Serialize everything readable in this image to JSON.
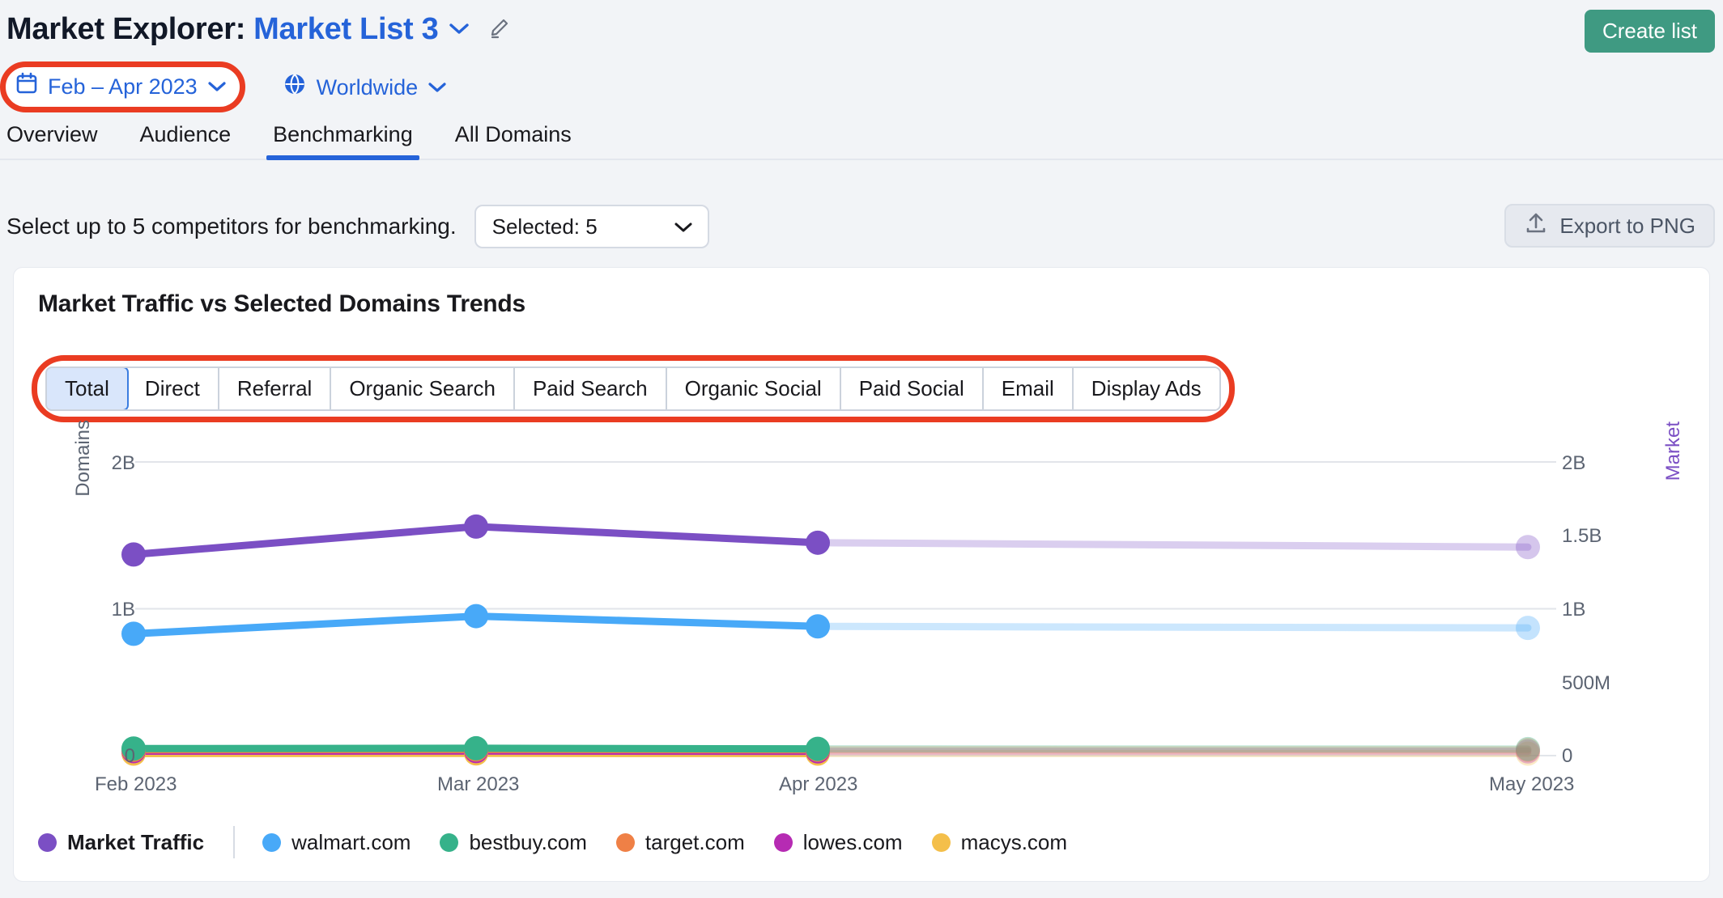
{
  "header": {
    "title_prefix": "Market Explorer:",
    "list_name": "Market List 3",
    "dropdown_icon": "chevron-down-icon",
    "edit_icon": "pencil-icon",
    "create_list_label": "Create list",
    "accent_blue": "#2563d9",
    "create_button_color": "#3f9a82"
  },
  "filters": {
    "date_range": "Feb – Apr 2023",
    "date_icon": "calendar-icon",
    "location": "Worldwide",
    "location_icon": "globe-icon",
    "highlight_color": "#ea3c22"
  },
  "tabs": [
    {
      "label": "Overview",
      "active": false
    },
    {
      "label": "Audience",
      "active": false
    },
    {
      "label": "Benchmarking",
      "active": true
    },
    {
      "label": "All Domains",
      "active": false
    }
  ],
  "toolbar": {
    "select_label": "Select up to 5 competitors for benchmarking.",
    "selected_value": "Selected: 5",
    "export_label": "Export to PNG",
    "export_icon": "upload-icon"
  },
  "card": {
    "title": "Market Traffic vs Selected Domains Trends"
  },
  "channels": [
    {
      "label": "Total",
      "active": true
    },
    {
      "label": "Direct",
      "active": false
    },
    {
      "label": "Referral",
      "active": false
    },
    {
      "label": "Organic Search",
      "active": false
    },
    {
      "label": "Paid Search",
      "active": false
    },
    {
      "label": "Organic Social",
      "active": false
    },
    {
      "label": "Paid Social",
      "active": false
    },
    {
      "label": "Email",
      "active": false
    },
    {
      "label": "Display Ads",
      "active": false
    }
  ],
  "chart_data": {
    "type": "line",
    "title": "Market Traffic vs Selected Domains Trends",
    "xlabel": "",
    "ylabel": "Domains",
    "y2label": "Market",
    "x": [
      "Feb 2023",
      "Mar 2023",
      "Apr 2023",
      "May 2023"
    ],
    "xtick_labels": [
      "Feb 2023",
      "Mar 2023",
      "Apr 2023",
      "May 2023"
    ],
    "ylim": [
      0,
      2000000000
    ],
    "ytick_labels": [
      "2B",
      "1B",
      "0"
    ],
    "ytick_values": [
      2000000000,
      1000000000,
      0
    ],
    "y2lim": [
      0,
      2000000000
    ],
    "y2tick_labels": [
      "2B",
      "1.5B",
      "1B",
      "500M",
      "0"
    ],
    "y2tick_values": [
      2000000000,
      1500000000,
      1000000000,
      500000000,
      0
    ],
    "grid": true,
    "legend_position": "bottom",
    "forecast_from": "Apr 2023",
    "series": [
      {
        "name": "Market Traffic",
        "color": "#7b4fc4",
        "axis": "right",
        "values": [
          1370000000,
          1560000000,
          1450000000,
          1420000000
        ]
      },
      {
        "name": "walmart.com",
        "color": "#48a9f8",
        "axis": "left",
        "values": [
          830000000,
          950000000,
          880000000,
          870000000
        ]
      },
      {
        "name": "bestbuy.com",
        "color": "#36b28a",
        "axis": "left",
        "values": [
          48000000,
          50000000,
          46000000,
          45000000
        ]
      },
      {
        "name": "target.com",
        "color": "#ef8046",
        "axis": "left",
        "values": [
          40000000,
          42000000,
          40000000,
          39000000
        ]
      },
      {
        "name": "lowes.com",
        "color": "#b62bb3",
        "axis": "left",
        "values": [
          30000000,
          31000000,
          29000000,
          29000000
        ]
      },
      {
        "name": "macys.com",
        "color": "#f4bf4a",
        "axis": "left",
        "values": [
          14000000,
          15000000,
          14000000,
          14000000
        ]
      }
    ]
  },
  "legend": [
    {
      "name": "Market Traffic",
      "color": "#7b4fc4",
      "primary": true
    },
    {
      "name": "walmart.com",
      "color": "#48a9f8",
      "primary": false
    },
    {
      "name": "bestbuy.com",
      "color": "#36b28a",
      "primary": false
    },
    {
      "name": "target.com",
      "color": "#ef8046",
      "primary": false
    },
    {
      "name": "lowes.com",
      "color": "#b62bb3",
      "primary": false
    },
    {
      "name": "macys.com",
      "color": "#f4bf4a",
      "primary": false
    }
  ]
}
